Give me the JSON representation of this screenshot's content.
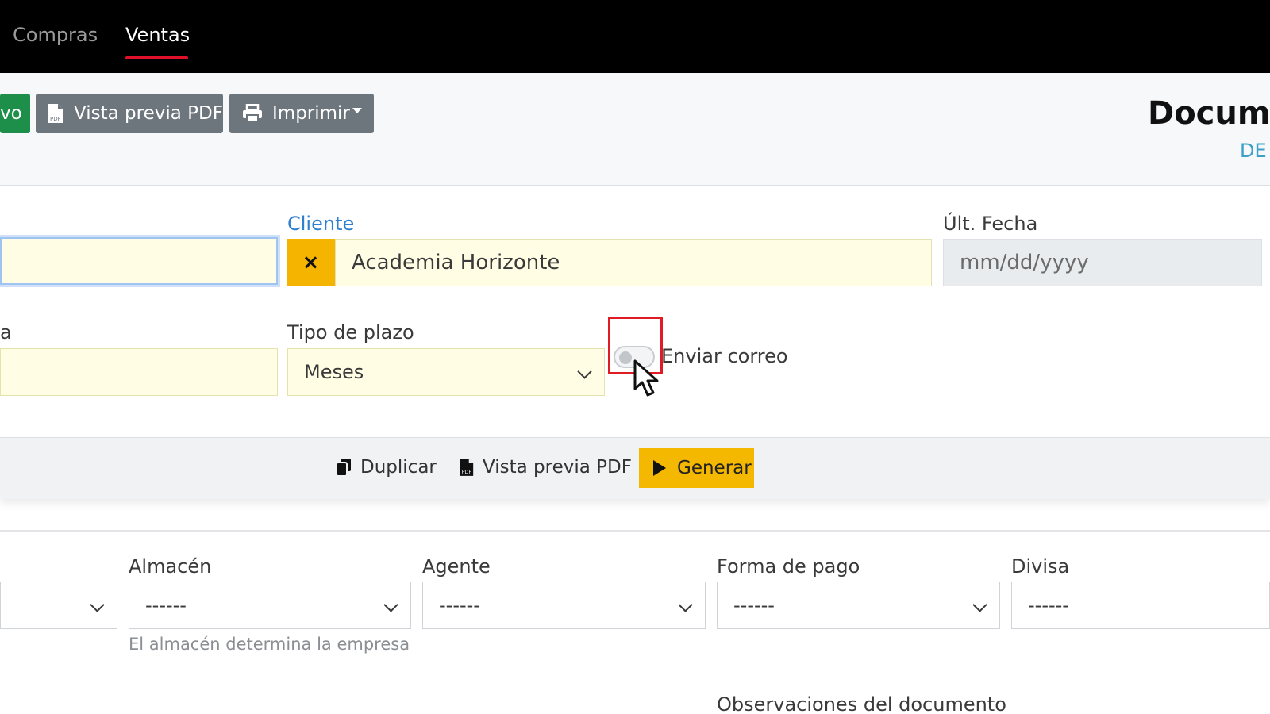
{
  "nav": {
    "tabs": [
      {
        "label": "Compras",
        "active": false
      },
      {
        "label": "Ventas",
        "active": true
      }
    ],
    "active_color": "#e0102a"
  },
  "toolbar": {
    "new_label": "vo",
    "pdf_label": "Vista previa PDF",
    "print_label": "Imprimir",
    "doc_title": "Docume",
    "doc_code": "DE"
  },
  "form": {
    "cliente_label": "Cliente",
    "cliente_value": "Academia Horizonte",
    "clear_icon": "×",
    "ult_fecha_label": "Últ. Fecha",
    "ult_fecha_placeholder": "mm/dd/yyyy",
    "left_label_partial": "a",
    "tipo_plazo_label": "Tipo de plazo",
    "tipo_plazo_value": "Meses",
    "enviar_correo_label": "Enviar correo",
    "enviar_correo_checked": false
  },
  "actions": {
    "duplicar_label": "Duplicar",
    "pdf_label": "Vista previa PDF",
    "generar_label": "Generar",
    "generar_color": "#f5b800"
  },
  "details": {
    "almacen_label": "Almacén",
    "almacen_value": "------",
    "almacen_help": "El almacén determina la empresa",
    "agente_label": "Agente",
    "agente_value": "------",
    "forma_pago_label": "Forma de pago",
    "forma_pago_value": "------",
    "divisa_label": "Divisa",
    "divisa_value": "------",
    "observaciones_label": "Observaciones del documento"
  }
}
